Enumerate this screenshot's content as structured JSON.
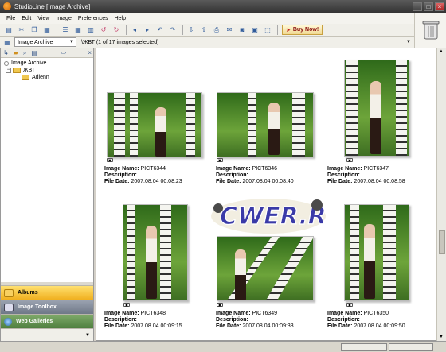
{
  "window": {
    "title": "StudioLine [Image Archive]",
    "min": "_",
    "max": "□",
    "close": "×"
  },
  "menu": [
    "File",
    "Edit",
    "View",
    "Image",
    "Preferences",
    "Help"
  ],
  "toolbar": {
    "buy_label": "Buy Now!",
    "buy_arrow": "➤"
  },
  "address": {
    "archive_combo": "Image Archive",
    "path": "\\ЖВТ (1 of 17 images selected)"
  },
  "tree": {
    "items": [
      "Image Archive",
      "ЖВТ",
      "Adienn"
    ]
  },
  "panels": {
    "grip": "....",
    "albums": "Albums",
    "toolbox": "Image Toolbox",
    "web": "Web Galleries"
  },
  "labels": {
    "image_name": "Image Name:",
    "description": "Description:",
    "file_date": "File Date:"
  },
  "images": [
    {
      "name": "PICT6344",
      "description": "",
      "date": "2007.08.04 00:08:23"
    },
    {
      "name": "PICT6346",
      "description": "",
      "date": "2007.08.04 00:08:40"
    },
    {
      "name": "PICT6347",
      "description": "",
      "date": "2007.08.04 00:08:58"
    },
    {
      "name": "PICT6348",
      "description": "",
      "date": "2007.08.04 00:09:15"
    },
    {
      "name": "PICT6349",
      "description": "",
      "date": "2007.08.04 00:09:33"
    },
    {
      "name": "PICT6350",
      "description": "",
      "date": "2007.08.04 00:09:50"
    }
  ],
  "watermark": "CWER.RU",
  "colors": {
    "active_panel": "#f0b020",
    "watermark": "#3a3aa8"
  }
}
